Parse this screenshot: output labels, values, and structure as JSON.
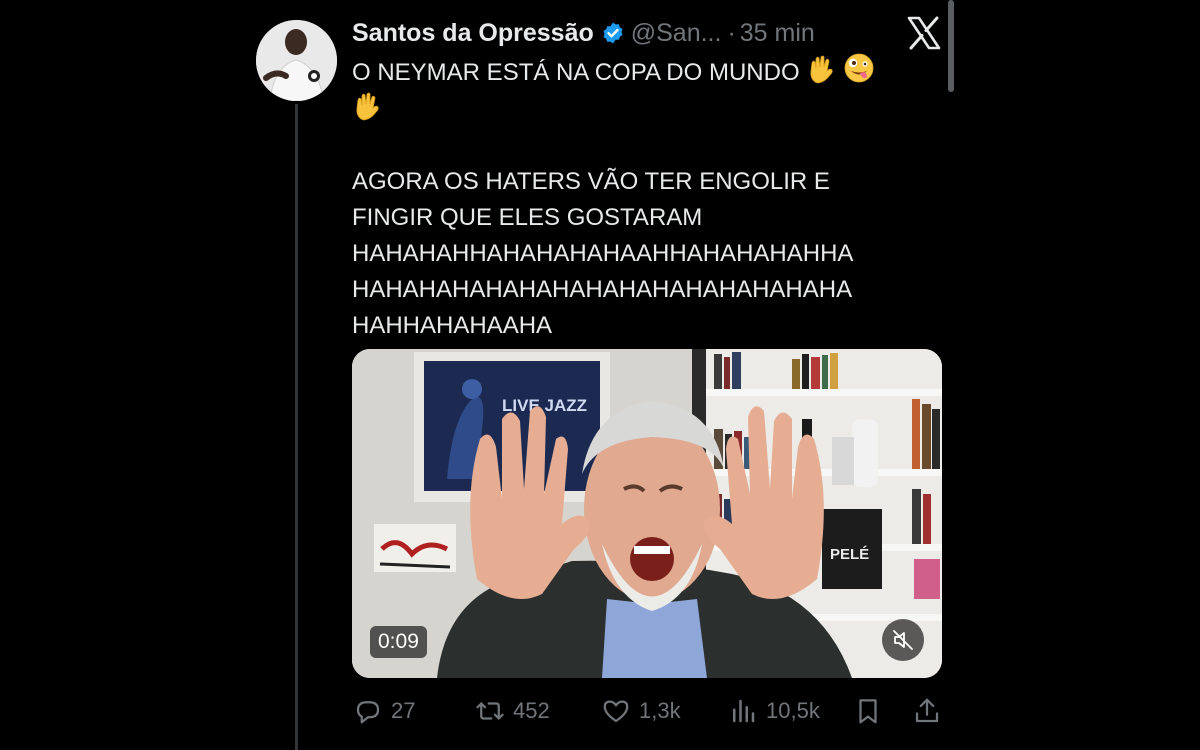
{
  "tweet": {
    "display_name": "Santos da Opressão",
    "handle": "@San...",
    "separator": "·",
    "time": "35 min",
    "text_line1": "O NEYMAR ESTÁ NA COPA DO MUNDO",
    "text_body": "AGORA OS HATERS VÃO TER ENGOLIR E\nFINGIR QUE ELES GOSTARAM\nHAHAHAHHAHAHAHAHAAHHAHAHAHAHHA\nHAHAHAHAHAHAHAHAHAHAHAHAHAHAHA\nHAHHAHAHAAHA",
    "emojis": [
      "waving-hand",
      "zany-face",
      "waving-hand"
    ]
  },
  "media": {
    "duration": "0:09",
    "poster_text": "LIVE JAZZ",
    "book_title": "PELÉ"
  },
  "actions": {
    "replies": "27",
    "retweets": "452",
    "likes": "1,3k",
    "views": "10,5k"
  },
  "icons": {
    "verified": "verified-badge-icon",
    "logo": "x-logo-icon",
    "reply": "reply-icon",
    "retweet": "retweet-icon",
    "like": "heart-icon",
    "views": "views-icon",
    "bookmark": "bookmark-icon",
    "share": "share-icon",
    "mute": "mute-icon"
  },
  "colors": {
    "background": "#000000",
    "text": "#e7e9ea",
    "muted": "#71767b",
    "verified": "#1d9bf0"
  }
}
